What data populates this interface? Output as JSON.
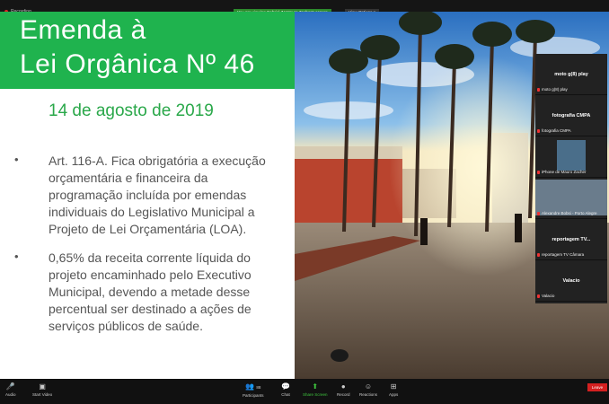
{
  "recording": {
    "label": "Recording"
  },
  "share_banner": {
    "text": "You are viewing Gabriel ZJ Mauro Zacher's screen",
    "view_options": "View Options"
  },
  "slide": {
    "title_line1": "Emenda à",
    "title_line2": "Lei Orgânica Nº 46",
    "date": "14 de agosto de 2019",
    "bullets": [
      {
        "lines": [
          "Art. 116-A. Fica obrigatória a execução",
          "orçamentária e financeira da",
          "programação incluída por emendas",
          "individuais do Legislativo Municipal a",
          "Projeto de Lei Orçamentária (LOA)."
        ]
      },
      {
        "lines": [
          "0,65% da receita corrente líquida do",
          "projeto encaminhado pelo Executivo",
          "Municipal, devendo a metade desse",
          "percentual ser destinado a ações de",
          "serviços públicos de saúde."
        ]
      }
    ]
  },
  "participants": [
    {
      "name": "moto g(8) play",
      "caption": "moto g(8) play"
    },
    {
      "name": "fotografia CMPA",
      "caption": "fotografia CMPA"
    },
    {
      "name": "",
      "caption": "iPhone de Mauro Zacher"
    },
    {
      "name": "",
      "caption": "Alexandre Bobsi - Porto Alegre"
    },
    {
      "name": "reportagem TV...",
      "caption": "reportagem TV Câmara"
    },
    {
      "name": "Valacio",
      "caption": "Valacio"
    }
  ],
  "toolbar": {
    "audio": "Audio",
    "video": "Start Video",
    "participants": "Participants",
    "participants_count": "88",
    "chat": "Chat",
    "share": "Share Screen",
    "record": "Record",
    "reactions": "Reactions",
    "apps": "Apps",
    "leave": "Leave"
  },
  "icons": {
    "mic": "mic-off-icon",
    "video": "video-off-icon",
    "participants": "people-icon",
    "chat": "chat-icon",
    "share": "share-screen-icon",
    "record": "record-icon",
    "reactions": "smile-icon",
    "apps": "apps-icon"
  },
  "colors": {
    "title_green": "#1fb34e",
    "share_green": "#2c8a2c",
    "leave_red": "#d42020"
  }
}
